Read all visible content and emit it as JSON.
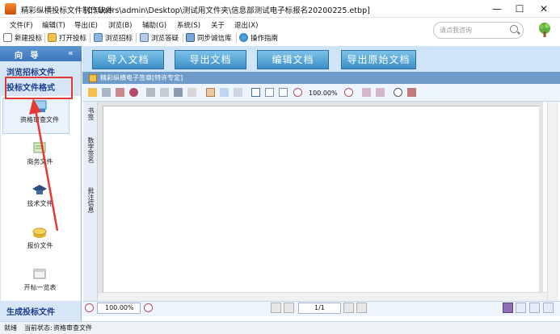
{
  "window": {
    "app_title": "精彩纵横投标文件制作软件",
    "file_path": "[C:\\Users\\admin\\Desktop\\测试用文件夹\\信息部测试电子标报名20200225.etbp]",
    "minimize": "—",
    "maximize": "☐",
    "close": "✕"
  },
  "menu": [
    "文件(F)",
    "编辑(T)",
    "导出(E)",
    "浏览(B)",
    "辅助(G)",
    "系统(S)",
    "关于",
    "退出(X)"
  ],
  "toolbar": [
    "新建投标",
    "打开投标",
    "浏览招标",
    "浏览答疑",
    "同步诚信库",
    "操作指南"
  ],
  "search": {
    "placeholder": "请点我咨询"
  },
  "nav": {
    "title": "向 导",
    "collapse": "«",
    "browse_tender": "浏览招标文件",
    "bid_format": "投标文件格式",
    "items": [
      "资格审查文件",
      "商务文件",
      "技术文件",
      "报价文件",
      "开标一览表"
    ],
    "generate": "生成投标文件"
  },
  "actions": [
    "导入文档",
    "导出文档",
    "编辑文档",
    "导出原始文档"
  ],
  "doc": {
    "header": "精彩纵横电子签章[特许专定]",
    "zoom": "100.00%"
  },
  "side_tabs": [
    "书签",
    "数字签名",
    "批注信息"
  ],
  "bottom": {
    "zoom": "100.00%",
    "page": "1/1"
  },
  "status": {
    "ready": "就绪",
    "current_label": "当前状态:",
    "current_value": "资格审查文件"
  },
  "colors": {
    "accent": "#3c76bd",
    "button": "#3b8fc8",
    "highlight": "#e53935"
  }
}
